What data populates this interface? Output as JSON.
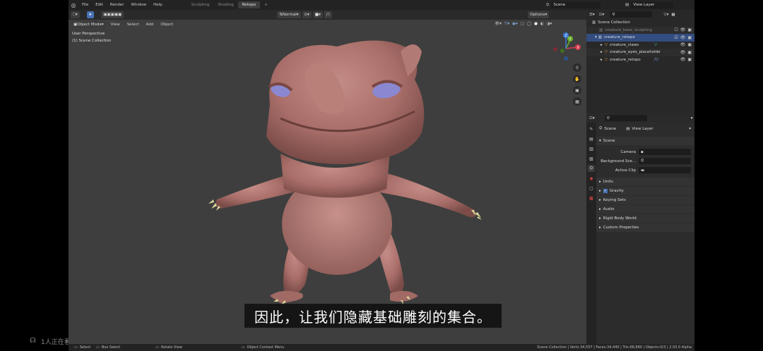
{
  "topbar": {
    "menu": [
      "File",
      "Edit",
      "Render",
      "Window",
      "Help"
    ],
    "workspaces": [
      "Sculpting",
      "Shading",
      "Retopo"
    ],
    "active_workspace": "Retopo",
    "plus": "+",
    "scene": "Scene",
    "view_layer": "View Layer"
  },
  "viewport_header": {
    "mode": "Object Mode",
    "menus": [
      "View",
      "Select",
      "Add",
      "Object"
    ],
    "orientation": "Normal",
    "options": "Options"
  },
  "viewport": {
    "perspective": "User Perspective",
    "collection": "(1) Scene Collection",
    "gizmo_axes": [
      "X",
      "Y",
      "Z"
    ]
  },
  "subtitle": "因此，让我们隐藏基础雕刻的集合。",
  "outliner": {
    "root": "Scene Collection",
    "items": [
      {
        "label": "creature_base_sculpting",
        "muted": true
      },
      {
        "label": "creature_retopo",
        "selected": true
      },
      {
        "label": "creature_claws"
      },
      {
        "label": "creature_eyes_placeholde"
      },
      {
        "label": "creature_retopo"
      }
    ]
  },
  "properties": {
    "breadcrumb_scene": "Scene",
    "breadcrumb_layer": "View Layer",
    "section": "Scene",
    "camera_label": "Camera",
    "bg_scene_label": "Background Sce...",
    "active_clip_label": "Active Clip",
    "panels": [
      "Units",
      "Gravity",
      "Keying Sets",
      "Audio",
      "Rigid Body World",
      "Custom Properties"
    ]
  },
  "statusbar": {
    "select": "Select",
    "box_select": "Box Select",
    "rotate_view": "Rotate View",
    "context_menu": "Object Context Menu",
    "stats": "Scene Collection | Verts:34,557 | Faces:34,440 | Tris:68,880 | Objects:0/3 | 2.93.0 Alpha"
  },
  "overlay": {
    "viewers": "1人正在看"
  }
}
